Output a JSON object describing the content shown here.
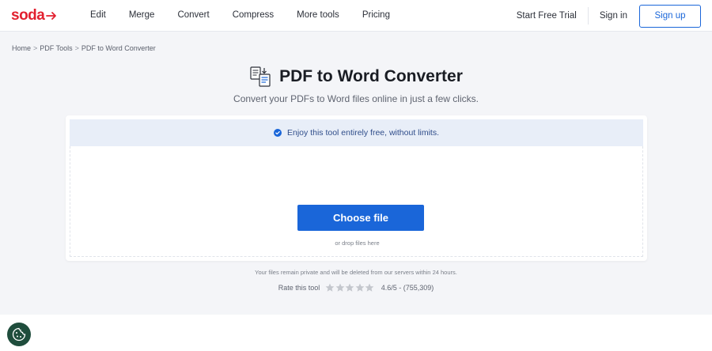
{
  "brand": {
    "logo_text": "soda",
    "logo_color": "#e2202f"
  },
  "nav": {
    "items": [
      {
        "label": "Edit"
      },
      {
        "label": "Merge"
      },
      {
        "label": "Convert"
      },
      {
        "label": "Compress"
      },
      {
        "label": "More tools"
      },
      {
        "label": "Pricing"
      }
    ],
    "trial_label": "Start Free Trial",
    "signin_label": "Sign in",
    "signup_label": "Sign up"
  },
  "breadcrumb": {
    "items": [
      "Home",
      "PDF Tools",
      "PDF to Word Converter"
    ],
    "separator": ">"
  },
  "page": {
    "title": "PDF to Word Converter",
    "subtitle": "Convert your PDFs to Word files online in just a few clicks.",
    "title_icon": "pdf-to-word-icon"
  },
  "upload": {
    "banner_text": "Enjoy this tool entirely free, without limits.",
    "choose_label": "Choose file",
    "drop_hint": "or drop files here"
  },
  "footer_note": {
    "privacy": "Your files remain private and will be deleted from our servers within 24 hours.",
    "rate_label": "Rate this tool",
    "rating": "4.6/5 - (755,309)",
    "stars_total": 5
  },
  "colors": {
    "accent": "#1a66d9",
    "background": "#f4f5f8",
    "banner_bg": "#e8eef8",
    "cookie_button": "#1f4d3c"
  },
  "icons": {
    "check": "check-circle-icon",
    "star": "star-icon",
    "cookie": "cookie-icon"
  }
}
